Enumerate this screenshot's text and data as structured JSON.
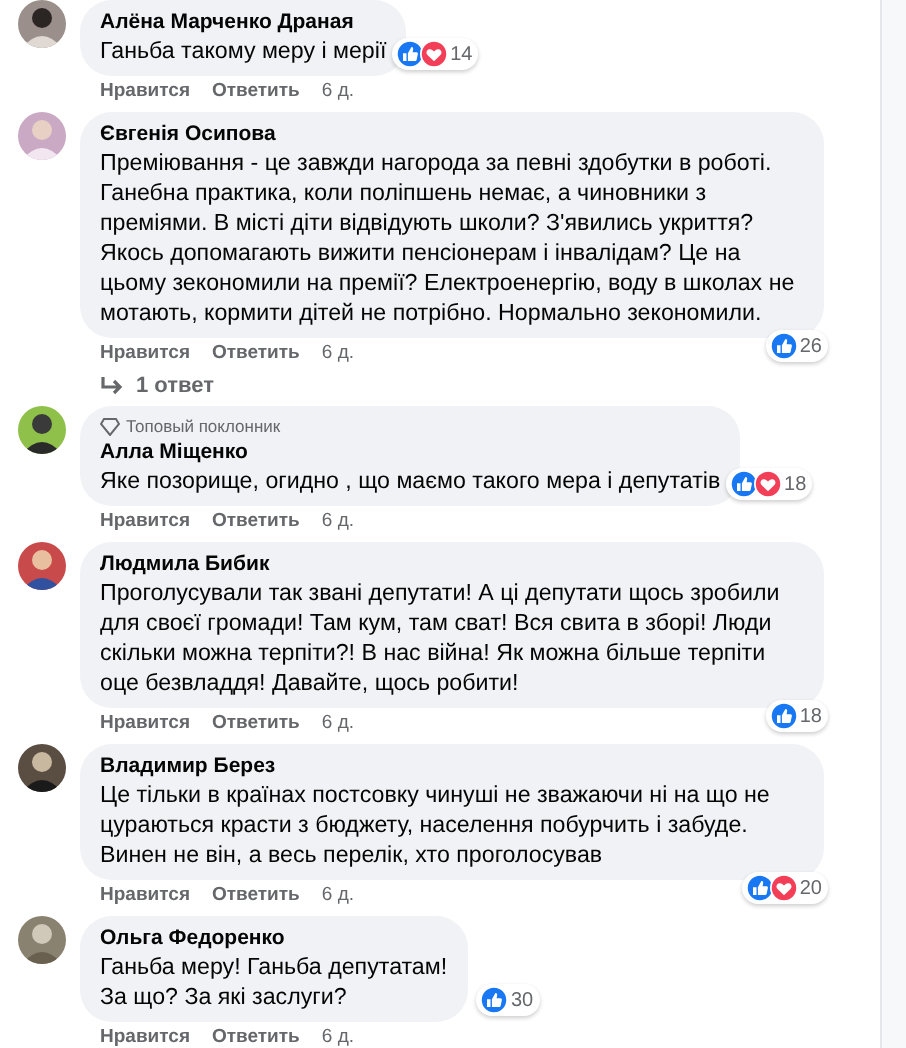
{
  "comments": [
    {
      "author": "Алёна Марченко Драная",
      "text": "Ганьба такому меру і мерії",
      "reactions": [
        {
          "kind": "like"
        },
        {
          "kind": "love"
        }
      ],
      "count": "14",
      "like": "Нравится",
      "reply": "Ответить",
      "time": "6 д."
    },
    {
      "author": "Євгенія Осипова",
      "text": "Преміювання - це завжди нагорода за певні здобутки в роботі. Ганебна практика, коли поліпшень немає, а чиновники з преміями. В місті діти відвідують школи? З'явились укриття? Якось допомагають вижити пенсіонерам і інвалідам? Це на цьому зекономили на премії? Електроенергію, воду в школах не мотають, кормити дітей не потрібно. Нормально зекономили.",
      "reactions": [
        {
          "kind": "like"
        }
      ],
      "count": "26",
      "like": "Нравится",
      "reply": "Ответить",
      "time": "6 д.",
      "replies": "1 ответ"
    },
    {
      "badge": "Топовый поклонник",
      "author": "Алла Міщенко",
      "text": "Яке позорище, огидно , що маємо такого мера і депутатів",
      "reactions": [
        {
          "kind": "like"
        },
        {
          "kind": "love"
        }
      ],
      "count": "18",
      "like": "Нравится",
      "reply": "Ответить",
      "time": "6 д."
    },
    {
      "author": "Людмила Бибик",
      "text": "Проголусували так звані депутати! А ці депутати щось зробили для своєї громади! Там кум, там сват! Вся свита в зборі! Люди скільки можна терпіти?! В нас війна! Як можна більше терпіти оце безвладдя! Давайте, щось робити!",
      "reactions": [
        {
          "kind": "like"
        }
      ],
      "count": "18",
      "like": "Нравится",
      "reply": "Ответить",
      "time": "6 д."
    },
    {
      "author": "Владимир Берез",
      "text": "Це тільки в країнах постсовку чинуші не зважаючи ні на що не цураються красти з бюджету, населення побурчить і забуде. Винен не він, а весь перелік, хто проголосував",
      "reactions": [
        {
          "kind": "like"
        },
        {
          "kind": "love"
        }
      ],
      "count": "20",
      "like": "Нравится",
      "reply": "Ответить",
      "time": "6 д."
    },
    {
      "author": "Ольга Федоренко",
      "text": "Ганьба меру! Ганьба депутатам!\nЗа що? За які заслуги?",
      "reactions": [
        {
          "kind": "like"
        }
      ],
      "count": "30",
      "like": "Нравится",
      "reply": "Ответить",
      "time": "6 д."
    }
  ]
}
